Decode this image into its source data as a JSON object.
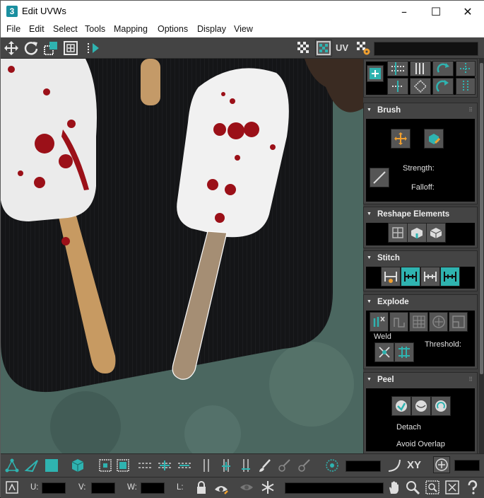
{
  "window": {
    "title": "Edit UVWs",
    "app_icon": "3",
    "controls": {
      "minimize": "–",
      "maximize": "☐",
      "close": "✕"
    }
  },
  "menu": [
    "File",
    "Edit",
    "Select",
    "Tools",
    "Mapping",
    "Options",
    "Display",
    "View"
  ],
  "toolbar": {
    "uv_label": "UV"
  },
  "panels": {
    "brush": {
      "title": "Brush",
      "strength_label": "Strength:",
      "falloff_label": "Falloff:"
    },
    "reshape": {
      "title": "Reshape Elements"
    },
    "stitch": {
      "title": "Stitch"
    },
    "explode": {
      "title": "Explode",
      "weld_label": "Weld",
      "threshold_label": "Threshold:"
    },
    "peel": {
      "title": "Peel",
      "detach_label": "Detach",
      "avoid_overlap_label": "Avoid Overlap"
    }
  },
  "bottom": {
    "xy_label": "XY",
    "u_label": "U:",
    "v_label": "V:",
    "w_label": "W:",
    "l_label": "L:"
  },
  "colors": {
    "accent": "#2fb3b0",
    "panel": "#444444",
    "field": "#000000"
  }
}
